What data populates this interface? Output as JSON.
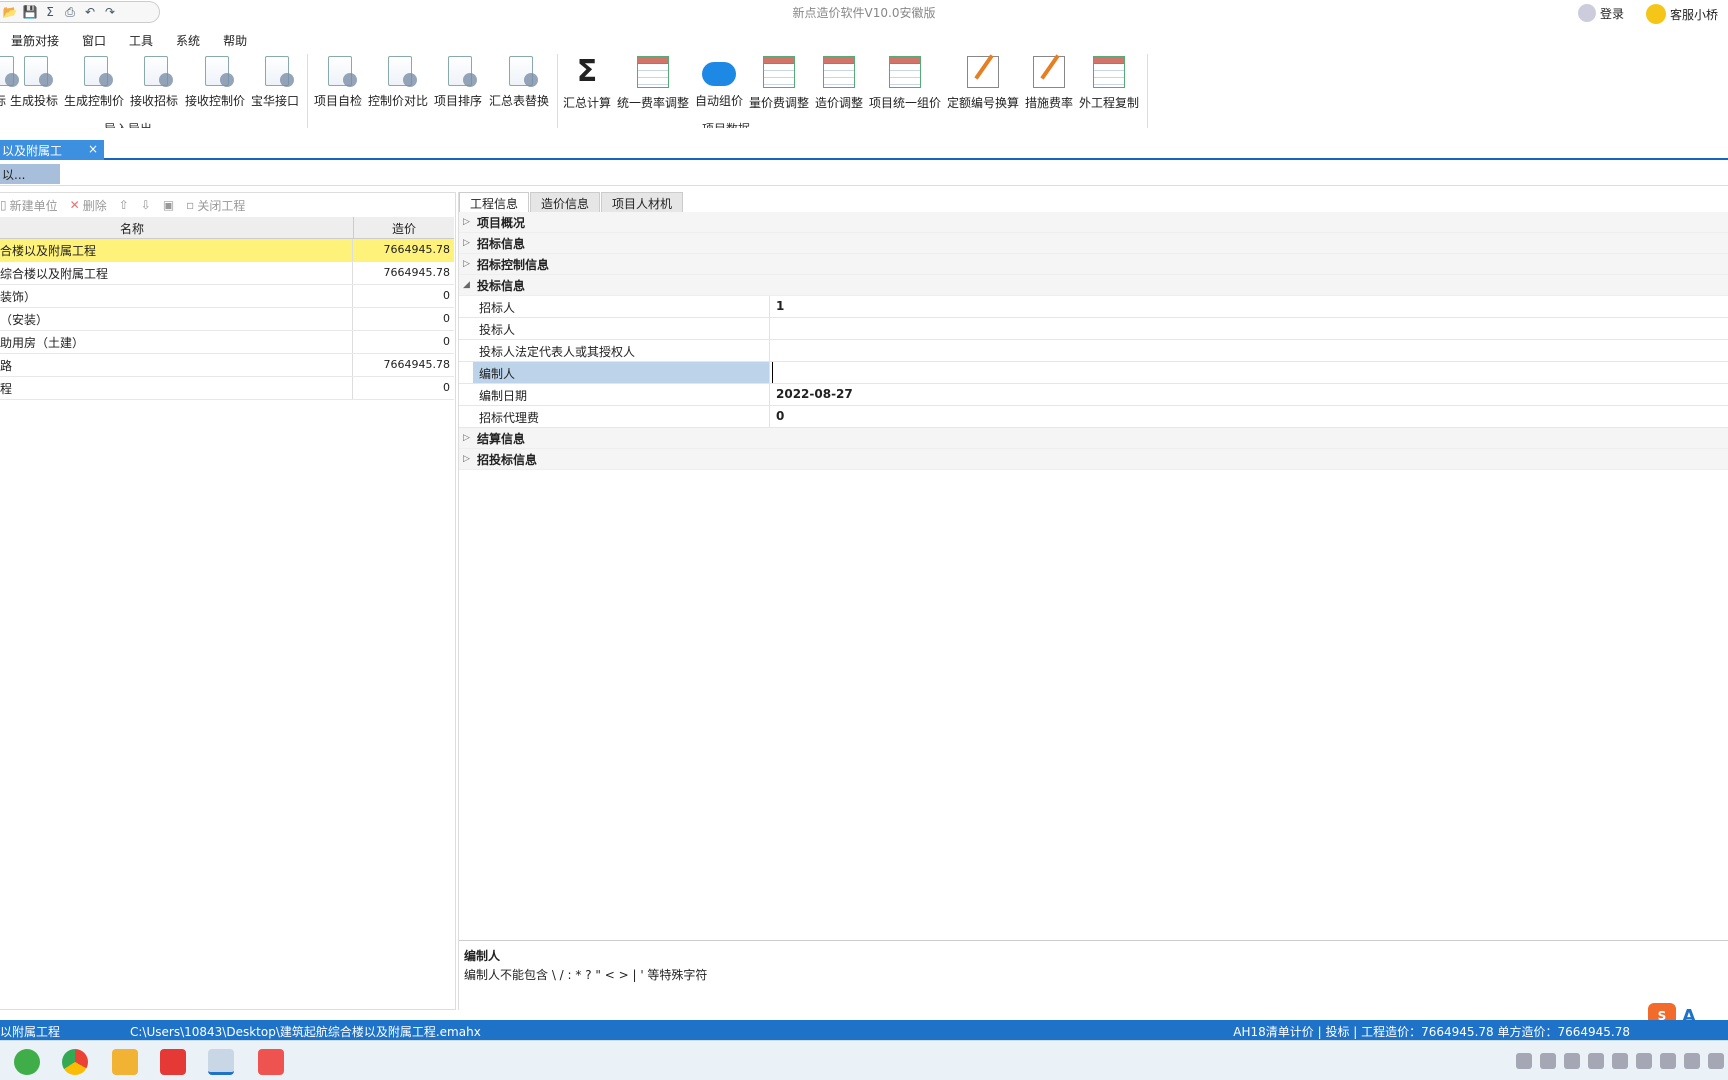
{
  "app": {
    "title": "新点造价软件V10.0安徽版",
    "login": "登录",
    "service": "客服小桥"
  },
  "quick_access": [
    "open-icon",
    "save-icon",
    "sigma-icon",
    "print-icon",
    "undo-icon",
    "redo-icon"
  ],
  "menu": [
    "量筋对接",
    "窗口",
    "工具",
    "系统",
    "帮助"
  ],
  "ribbon": {
    "group1_label": "导入导出",
    "group2_label": "项目数据",
    "buttons1": [
      {
        "label": "标",
        "icon": "doc-icon"
      },
      {
        "label": "生成投标",
        "icon": "doc-icon"
      },
      {
        "label": "生成控制价",
        "icon": "doc-icon"
      },
      {
        "label": "接收招标",
        "icon": "doc-icon"
      },
      {
        "label": "接收控制价",
        "icon": "doc-icon"
      },
      {
        "label": "宝华接口",
        "icon": "doc-icon"
      }
    ],
    "buttons2": [
      {
        "label": "项目自检",
        "icon": "check-icon"
      },
      {
        "label": "控制价对比",
        "icon": "compare-icon"
      },
      {
        "label": "项目排序",
        "icon": "sort-icon"
      },
      {
        "label": "汇总表替换",
        "icon": "replace-icon"
      },
      {
        "label": "汇总计算",
        "icon": "sigma-icon"
      },
      {
        "label": "统一费率调整",
        "icon": "grid-icon"
      },
      {
        "label": "自动组价",
        "icon": "cloud-icon"
      },
      {
        "label": "量价费调整",
        "icon": "grid-icon"
      },
      {
        "label": "造价调整",
        "icon": "grid-icon"
      },
      {
        "label": "项目统一组价",
        "icon": "grid-icon"
      },
      {
        "label": "定额编号换算",
        "icon": "abc-icon"
      },
      {
        "label": "措施费率",
        "icon": "pen-icon"
      },
      {
        "label": "外工程复制",
        "icon": "grid-icon"
      }
    ]
  },
  "doc_tab": {
    "label": "以及附属工程.e...",
    "close": "×"
  },
  "sub_button": "以...",
  "left": {
    "toolbar": {
      "new_unit": "新建单位",
      "delete": "删除",
      "close_project": "关闭工程"
    },
    "headers": {
      "name": "名称",
      "price": "造价"
    },
    "rows": [
      {
        "name": "合楼以及附属工程",
        "price": "7664945.78"
      },
      {
        "name": "综合楼以及附属工程",
        "price": "7664945.78"
      },
      {
        "name": "装饰）",
        "price": "0"
      },
      {
        "name": "（安装）",
        "price": "0"
      },
      {
        "name": "助用房（土建）",
        "price": "0"
      },
      {
        "name": "路",
        "price": "7664945.78"
      },
      {
        "name": "程",
        "price": "0"
      }
    ]
  },
  "right": {
    "tabs": [
      "工程信息",
      "造价信息",
      "项目人材机"
    ],
    "categories": {
      "c1": "项目概况",
      "c2": "招标信息",
      "c3": "招标控制信息",
      "c4": "投标信息",
      "c5": "结算信息",
      "c6": "招投标信息"
    },
    "bid_rows": [
      {
        "k": "招标人",
        "v": "1"
      },
      {
        "k": "投标人",
        "v": ""
      },
      {
        "k": "投标人法定代表人或其授权人",
        "v": ""
      },
      {
        "k": "编制人",
        "v": ""
      },
      {
        "k": "编制日期",
        "v": "2022-08-27"
      },
      {
        "k": "招标代理费",
        "v": "0"
      }
    ],
    "desc_title": "编制人",
    "desc_text": "编制人不能包含 \\ / : * ? \" < > | ' 等特殊字符"
  },
  "status": {
    "left": "以附属工程",
    "path": "C:\\Users\\10843\\Desktop\\建筑起航综合楼以及附属工程.emahx",
    "right": "AH18清单计价 | 投标 | 工程造价：7664945.78 单方造价：7664945.78"
  },
  "ime": {
    "s": "S",
    "a": "A"
  },
  "colors": {
    "accent": "#1e73c8",
    "selected_row": "#fff27a",
    "selected_key": "#bdd3ea"
  }
}
